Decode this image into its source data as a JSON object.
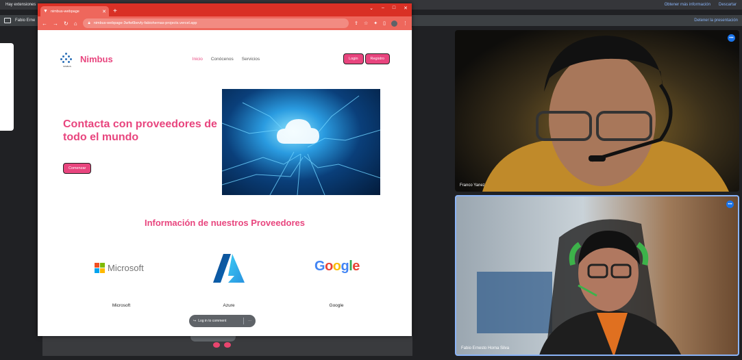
{
  "meet": {
    "notice": "Hay extensiones",
    "more_info": "Obtener más información",
    "dismiss": "Descartar",
    "presenter": "Fabio Erne",
    "stop_presenting": "Detener la presentación"
  },
  "browser": {
    "tab_title": "nimbus-webpage",
    "url": "nimbus-webpage-3wfw6bevly-fabiohernas-projects.vercel.app"
  },
  "site": {
    "brand": "Nimbus",
    "logo_caption": "NIMBUS",
    "nav": [
      "Inicio",
      "Conócenos",
      "Servicios"
    ],
    "login": "Login",
    "register": "Registro",
    "hero_title": "Contacta con proveedores de todo el mundo",
    "hero_button": "Comenzar",
    "section_title": "Información de nuestros Proveedores",
    "providers": [
      {
        "name": "Microsoft",
        "logo_text": "Microsoft"
      },
      {
        "name": "Azure"
      },
      {
        "name": "Google",
        "logo_text": "Google"
      }
    ],
    "comment_label": "Log in to comment"
  },
  "participants": [
    {
      "name": "Franco Yanez"
    },
    {
      "name": "Fabio Ernesto Horna Silva"
    }
  ],
  "colors": {
    "brand": "#e8457e",
    "chrome": "#d93025"
  }
}
